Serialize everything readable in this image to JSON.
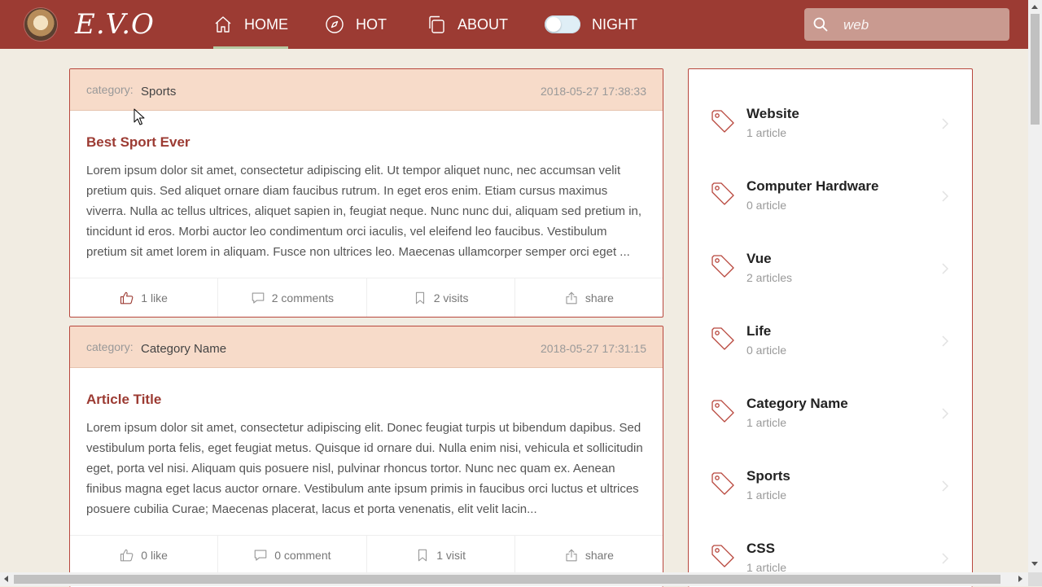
{
  "header": {
    "logo": "E.V.O",
    "nav": [
      {
        "label": "HOME",
        "icon": "home-icon"
      },
      {
        "label": "HOT",
        "icon": "compass-icon"
      },
      {
        "label": "ABOUT",
        "icon": "copy-icon"
      },
      {
        "label": "NIGHT",
        "icon": "toggle-switch"
      }
    ],
    "search": {
      "placeholder": "web"
    }
  },
  "articles": [
    {
      "category_label": "category:",
      "category": "Sports",
      "date": "2018-05-27 17:38:33",
      "title": "Best Sport Ever",
      "excerpt": "Lorem ipsum dolor sit amet, consectetur adipiscing elit. Ut tempor aliquet nunc, nec accumsan velit pretium quis. Sed aliquet ornare diam faucibus rutrum. In eget eros enim. Etiam cursus maximus viverra. Nulla ac tellus ultrices, aliquet sapien in, feugiat neque. Nunc nunc dui, aliquam sed pretium in, tincidunt id eros. Morbi auctor leo condimentum orci iaculis, vel eleifend leo faucibus. Vestibulum pretium sit amet lorem in aliquam. Fusce non ultrices leo. Maecenas ullamcorper semper orci eget ...",
      "likes": "1 like",
      "comments": "2 comments",
      "visits": "2 visits",
      "share": "share"
    },
    {
      "category_label": "category:",
      "category": "Category Name",
      "date": "2018-05-27 17:31:15",
      "title": "Article Title",
      "excerpt": "Lorem ipsum dolor sit amet, consectetur adipiscing elit. Donec feugiat turpis ut bibendum dapibus. Sed vestibulum porta felis, eget feugiat metus. Quisque id ornare dui. Nulla enim nisi, vehicula et sollicitudin eget, porta vel nisi. Aliquam quis posuere nisl, pulvinar rhoncus tortor. Nunc nec quam ex. Aenean finibus magna eget lacus auctor ornare. Vestibulum ante ipsum primis in faucibus orci luctus et ultrices posuere cubilia Curae; Maecenas placerat, lacus et porta venenatis, elit velit lacin...",
      "likes": "0 like",
      "comments": "0 comment",
      "visits": "1 visit",
      "share": "share"
    }
  ],
  "sidebar": {
    "categories": [
      {
        "name": "Website",
        "count": "1 article"
      },
      {
        "name": "Computer Hardware",
        "count": "0 article"
      },
      {
        "name": "Vue",
        "count": "2 articles"
      },
      {
        "name": "Life",
        "count": "0 article"
      },
      {
        "name": "Category Name",
        "count": "1 article"
      },
      {
        "name": "Sports",
        "count": "1 article"
      },
      {
        "name": "CSS",
        "count": "1 article"
      }
    ]
  },
  "colors": {
    "header": "#9c3b33",
    "accent": "#9c3b33",
    "card_head": "#f7dbc9",
    "page_bg": "#f1ece2"
  }
}
